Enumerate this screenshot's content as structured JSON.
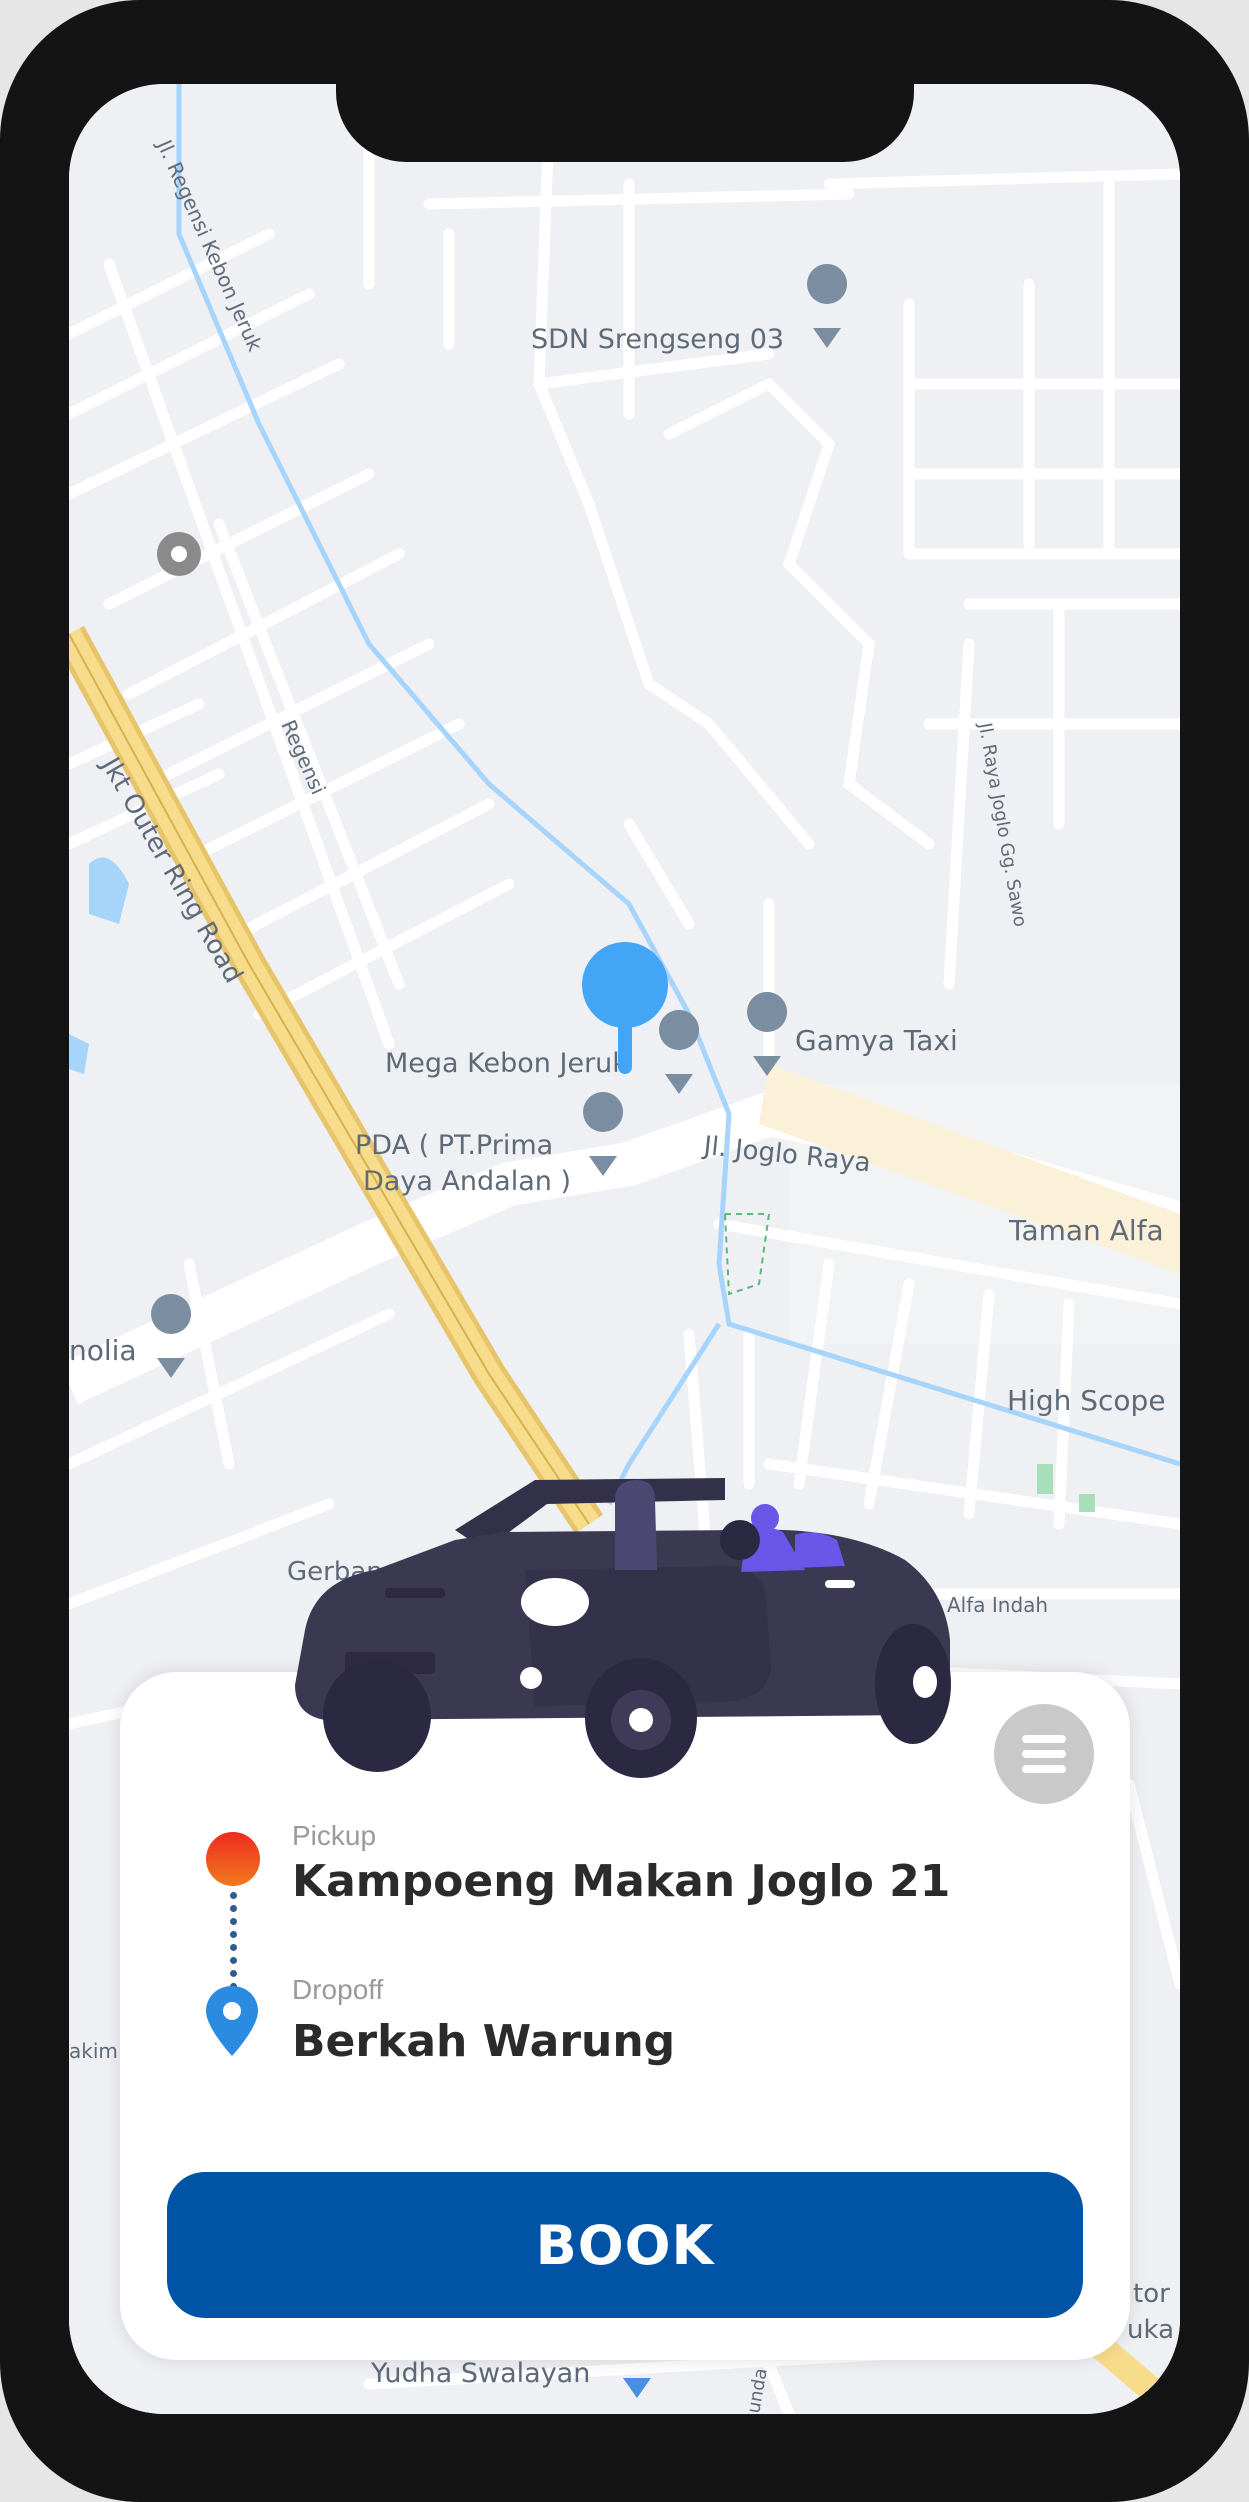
{
  "map": {
    "labels": {
      "sdn": "SDN Srengseng 03",
      "regensi_kebon_jeruk": "Jl. Regensi Kebon Jeruk",
      "regensi": "Regensi",
      "outer_ring": "Jkt Outer Ring Road",
      "raya_joglo_sawo": "Jl. Raya Joglo Gg. Sawo",
      "gamya_taxi": "Gamya Taxi",
      "mega_kebon_jeruk": "Mega Kebon Jeruk",
      "pda_line1": "PDA ( PT.Prima",
      "pda_line2": "Daya Andalan )",
      "joglo_raya": "Jl. Joglo Raya",
      "taman_alfa": "Taman Alfa",
      "magnolia": "nolia",
      "high_scope": "High Scope",
      "gerbang": "Gerbang T",
      "alfa_indah": "Alfa Indah",
      "akim": "akim",
      "yudha_swalayan": "Yudha Swalayan",
      "unda": "unda",
      "right_edge_top": "tor",
      "right_edge_bottom": "uka"
    }
  },
  "booking": {
    "pickup_label": "Pickup",
    "pickup_value": "Kampoeng Makan Joglo 21",
    "dropoff_label": "Dropoff",
    "dropoff_value": "Berkah Warung",
    "book_label": "BOOK"
  },
  "colors": {
    "accent": "#0053a5",
    "pin": "#42a5f5",
    "pickup_top": "#ee2b1e",
    "pickup_bottom": "#f07a1d",
    "car_body": "#3b3852",
    "passenger": "#6a56e8"
  },
  "icons": {
    "menu": "hamburger-icon",
    "center_pin": "location-pin-icon",
    "pickup": "pickup-dot-icon",
    "dropoff": "dropoff-pin-icon",
    "car": "convertible-car-icon"
  }
}
